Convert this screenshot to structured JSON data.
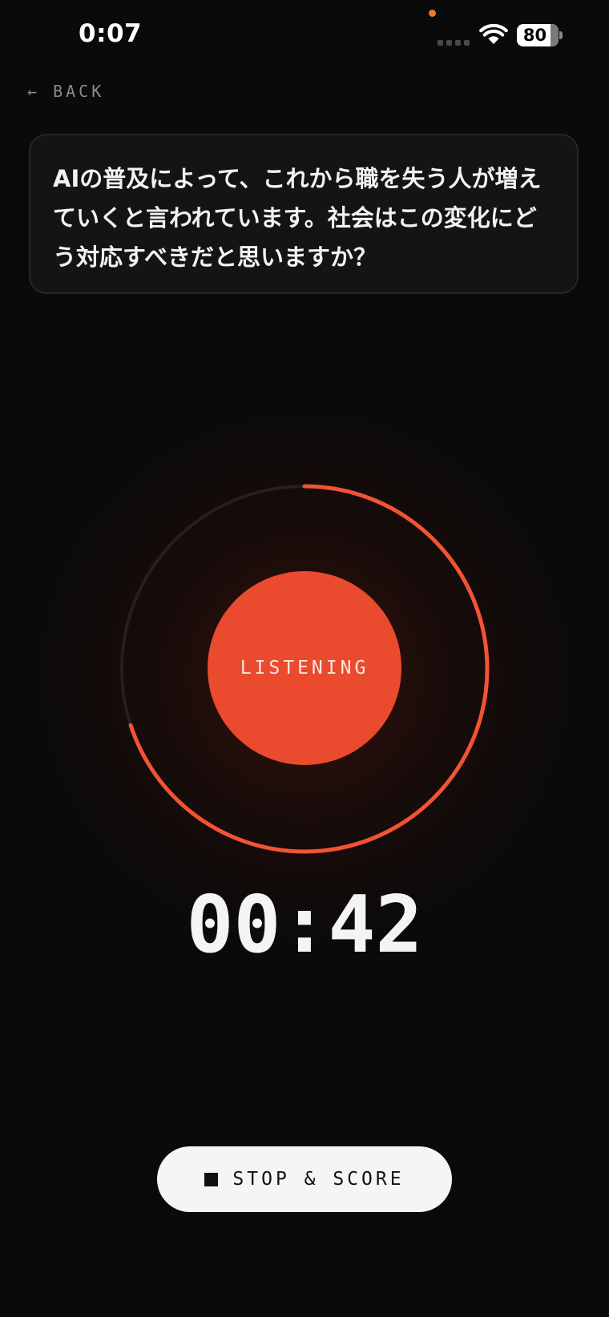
{
  "status_bar": {
    "time": "0:07",
    "battery_level": "80"
  },
  "nav": {
    "back_label": "← BACK"
  },
  "prompt": {
    "text": "AIの普及によって、これから職を失う人が増えていくと言われています。社会はこの変化にどう対応すべきだと思いますか？"
  },
  "recorder": {
    "state_label": "LISTENING",
    "timer": "00:42",
    "progress_fraction": 0.7,
    "accent_color": "#ea4a2e",
    "ring_color": "#f25334",
    "track_color": "#2a1e1c"
  },
  "controls": {
    "stop_label": "STOP & SCORE",
    "stop_icon": "stop-square-icon"
  },
  "icons": {
    "back": "arrow-left-icon",
    "wifi": "wifi-icon",
    "signal": "cellular-signal-icon",
    "battery": "battery-icon",
    "mic_indicator": "mic-in-use-dot-icon"
  }
}
